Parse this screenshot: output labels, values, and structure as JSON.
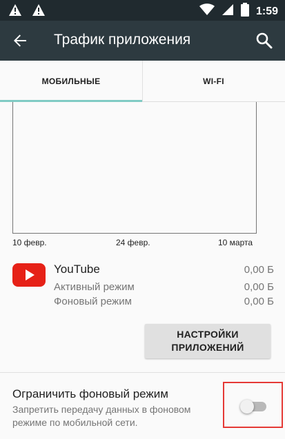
{
  "status_bar": {
    "time": "1:59",
    "icons": [
      "warning-icon",
      "warning-icon",
      "wifi-icon",
      "cellular-signal-icon",
      "battery-icon"
    ]
  },
  "app_bar": {
    "title": "Трафик приложения",
    "back_icon": "arrow-back-icon",
    "search_icon": "search-icon"
  },
  "tabs": [
    {
      "label": "МОБИЛЬНЫЕ",
      "selected": true
    },
    {
      "label": "WI-FI",
      "selected": false
    }
  ],
  "chart_data": {
    "type": "line",
    "x": [
      "10 февр.",
      "24 февр.",
      "10 марта"
    ],
    "series": [],
    "grid": false
  },
  "app": {
    "name": "YouTube",
    "total": "0,00 Б",
    "foreground_label": "Активный режим",
    "foreground_value": "0,00 Б",
    "background_label": "Фоновый режим",
    "background_value": "0,00 Б"
  },
  "settings_button": {
    "line1": "НАСТРОЙКИ",
    "line2": "ПРИЛОЖЕНИЙ"
  },
  "restrict_background": {
    "title": "Ограничить фоновый режим",
    "description": "Запретить передачу данных в фоновом режиме по мобильной сети.",
    "enabled": false
  },
  "colors": {
    "status_bar": "#202a2f",
    "app_bar": "#2d3a40",
    "tab_indicator": "#80cbc4",
    "highlight": "#e53935",
    "youtube_red": "#e62117"
  }
}
